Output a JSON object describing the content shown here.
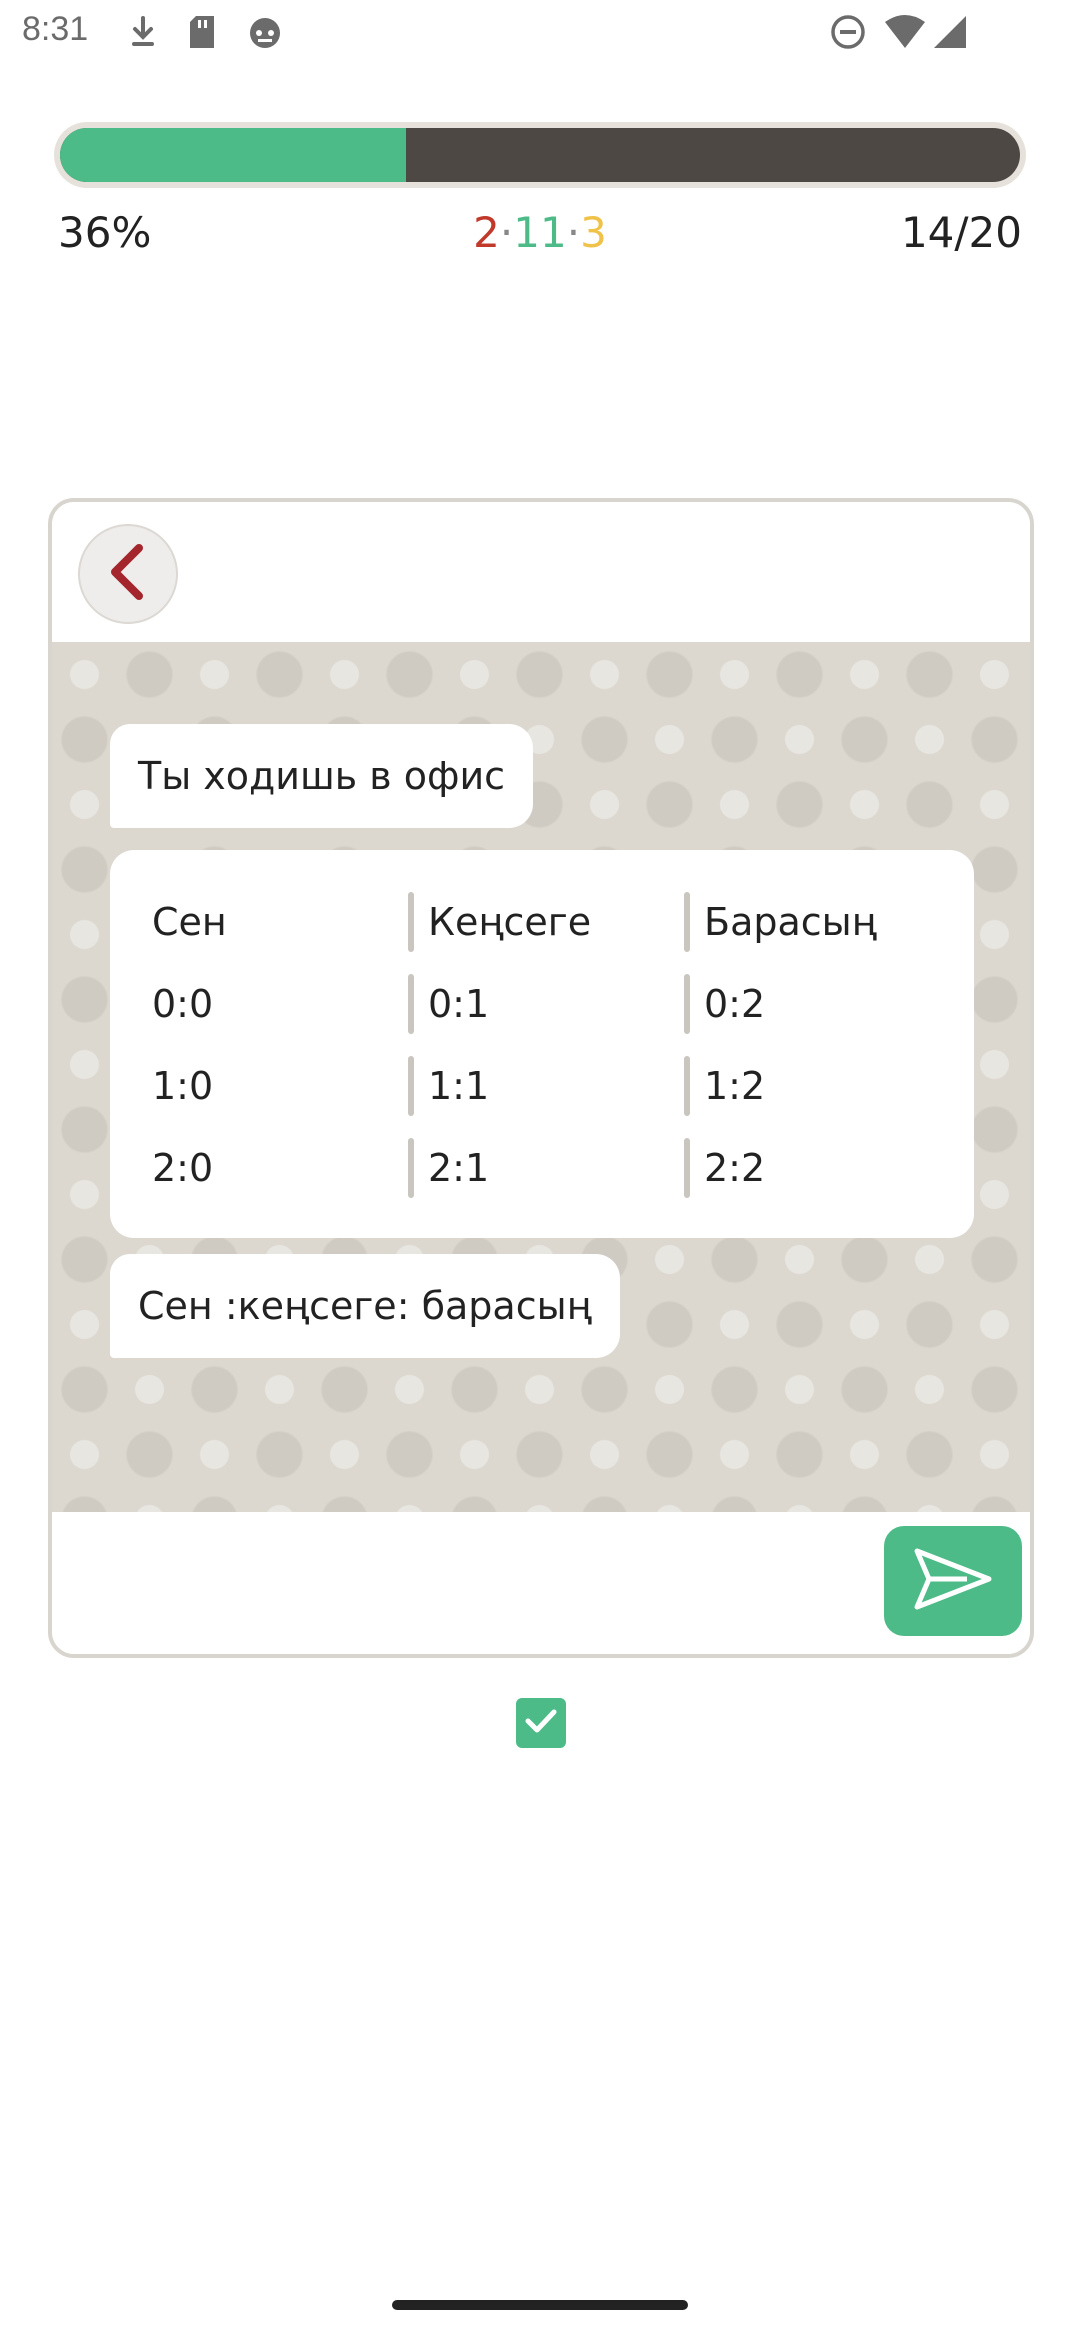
{
  "status_bar": {
    "time": "8:31",
    "left_icons": [
      "download-arrow-icon",
      "sd-card-icon",
      "robot-face-icon"
    ],
    "right_icons": [
      "do-not-disturb-icon",
      "wifi-icon",
      "cellular-signal-icon"
    ]
  },
  "progress": {
    "fraction_complete": 0.36,
    "percent_label": "36%",
    "count_red": "2",
    "count_green": "11",
    "count_yellow": "3",
    "separator": "·",
    "fraction_label": "14/20",
    "colors": {
      "fill": "#4dbb88",
      "track": "#4d4843",
      "red": "#c0392b",
      "green": "#4dbb88",
      "yellow": "#f0c24a"
    }
  },
  "chat": {
    "back_icon": "chevron-left-icon",
    "messages": [
      {
        "text": "Ты ходишь в офис"
      },
      {
        "table": {
          "headers": [
            "Сен",
            "Кеңсеге",
            "Барасың"
          ],
          "rows": [
            [
              "0:0",
              "0:1",
              "0:2"
            ],
            [
              "1:0",
              "1:1",
              "1:2"
            ],
            [
              "2:0",
              "2:1",
              "2:2"
            ]
          ]
        }
      },
      {
        "text": "Сен :кеңсеге: барасың"
      }
    ],
    "input": {
      "value": "",
      "placeholder": ""
    },
    "send_icon": "send-icon"
  },
  "checkbox": {
    "checked": true,
    "icon": "checkmark-icon"
  }
}
